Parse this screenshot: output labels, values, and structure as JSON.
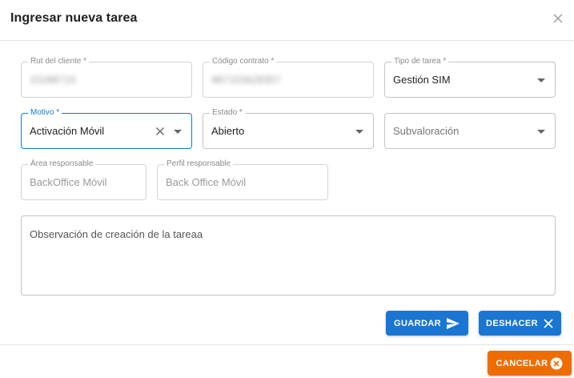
{
  "dialog": {
    "title": "Ingresar nueva tarea"
  },
  "fields": {
    "rut": {
      "label": "Rut del cliente *",
      "value": "15288715"
    },
    "codigo": {
      "label": "Código contrato *",
      "value": "987153628357"
    },
    "tipo": {
      "label": "Tipo de tarea *",
      "value": "Gestión SIM"
    },
    "motivo": {
      "label": "Motivo *",
      "value": "Activación Móvil"
    },
    "estado": {
      "label": "Estado *",
      "value": "Abierto"
    },
    "subvaloracion": {
      "placeholder": "Subvaloración"
    },
    "area": {
      "label": "Área responsable",
      "value": "BackOffice Móvil"
    },
    "perfil": {
      "label": "Perfil responsable",
      "value": "Back Office Móvil"
    },
    "observacion": {
      "placeholder": "Observación de creación de la tareaa"
    }
  },
  "buttons": {
    "guardar": "GUARDAR",
    "deshacer": "DESHACER",
    "cancelar": "CANCELAR"
  },
  "colors": {
    "primary": "#1976d2",
    "cancel": "#ef6c00"
  }
}
